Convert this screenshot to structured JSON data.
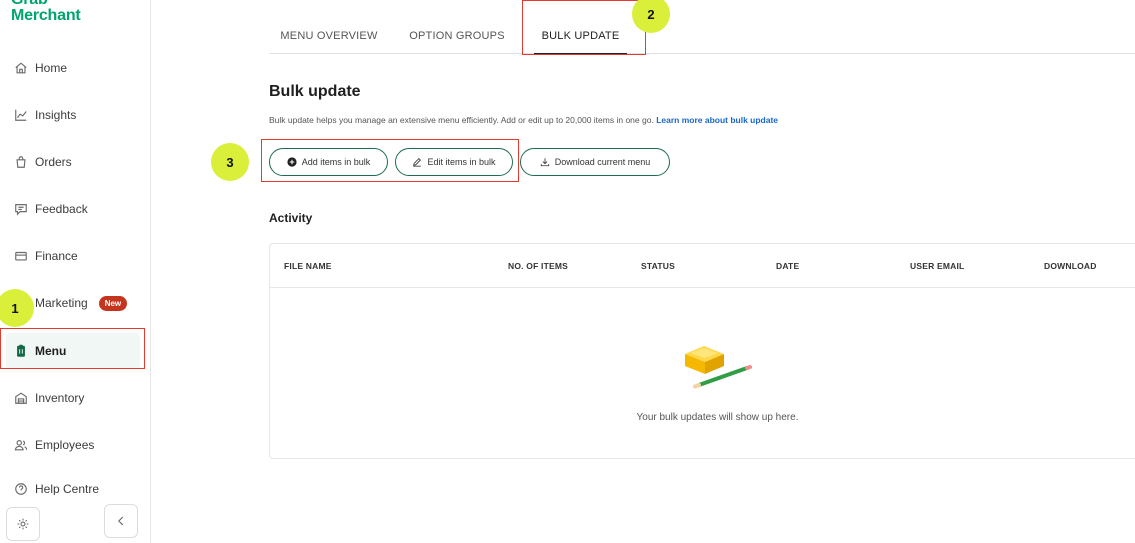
{
  "brand": {
    "line1": "Grab",
    "line2": "Merchant",
    "color": "#00a56b"
  },
  "sidebar": {
    "items": [
      {
        "label": "Home",
        "icon": "home-icon"
      },
      {
        "label": "Insights",
        "icon": "insights-icon"
      },
      {
        "label": "Orders",
        "icon": "orders-icon"
      },
      {
        "label": "Feedback",
        "icon": "feedback-icon"
      },
      {
        "label": "Finance",
        "icon": "finance-icon"
      },
      {
        "label": "Marketing",
        "icon": "marketing-icon",
        "badge": "New"
      },
      {
        "label": "Menu",
        "icon": "menu-icon",
        "active": true
      },
      {
        "label": "Inventory",
        "icon": "inventory-icon"
      },
      {
        "label": "Employees",
        "icon": "employees-icon"
      },
      {
        "label": "Help Centre",
        "icon": "help-icon"
      }
    ],
    "bottom": {
      "settings_icon": "gear-icon",
      "collapse_icon": "chevron-left-icon"
    }
  },
  "tabs": [
    {
      "label": "MENU OVERVIEW"
    },
    {
      "label": "OPTION GROUPS"
    },
    {
      "label": "BULK UPDATE",
      "active": true
    }
  ],
  "main": {
    "title": "Bulk update",
    "description": "Bulk update helps you manage an extensive menu efficiently. Add or edit up to 20,000 items in one go.",
    "learn_more": "Learn more about bulk update",
    "buttons": {
      "add": "Add items in bulk",
      "edit": "Edit items in bulk",
      "download": "Download current menu"
    },
    "activity_title": "Activity",
    "table": {
      "columns": [
        "FILE NAME",
        "NO. OF ITEMS",
        "STATUS",
        "DATE",
        "USER EMAIL",
        "DOWNLOAD"
      ],
      "rows": [],
      "empty_message": "Your bulk updates will show up here."
    }
  },
  "annotations": {
    "markers": [
      "1",
      "2",
      "3"
    ],
    "box_color": "#e23a2e",
    "dot_color": "#d9ef3a"
  },
  "colors": {
    "accent": "#1d6b52",
    "badge": "#c5341e",
    "link": "#1a67c9"
  }
}
